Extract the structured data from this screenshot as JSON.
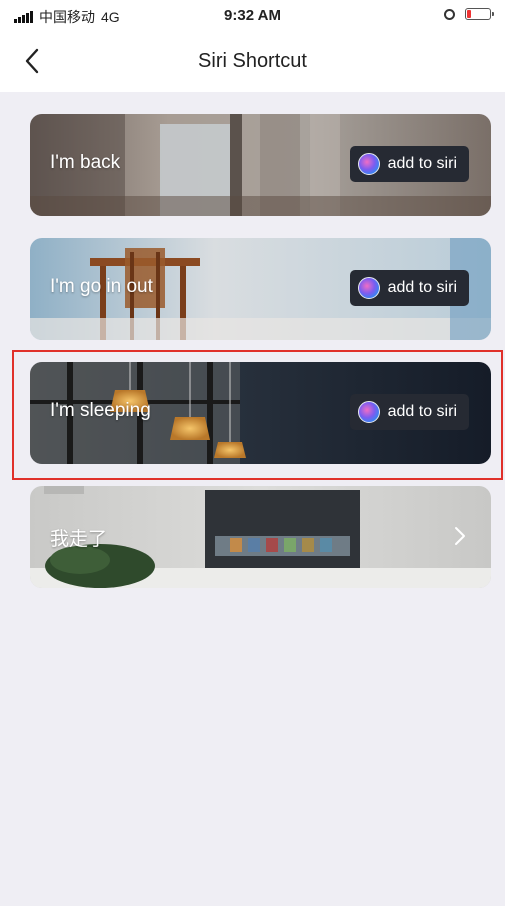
{
  "status_bar": {
    "carrier": "中国移动",
    "network": "4G",
    "time": "9:32 AM",
    "battery_level": 0.2
  },
  "nav": {
    "title": "Siri Shortcut",
    "back_icon": "chevron-left-icon"
  },
  "shortcuts": [
    {
      "label": "I'm back",
      "action_label": "add to siri"
    },
    {
      "label": "I'm go in out",
      "action_label": "add to siri"
    },
    {
      "label": "I'm sleeping",
      "action_label": "add to siri",
      "highlighted": true
    },
    {
      "label": "我走了",
      "action_icon": "chevron-right-icon"
    }
  ],
  "colors": {
    "background": "#efeef4",
    "highlight_border": "#e0302a",
    "siri_button": "#262a33",
    "battery_low": "#e33333"
  }
}
